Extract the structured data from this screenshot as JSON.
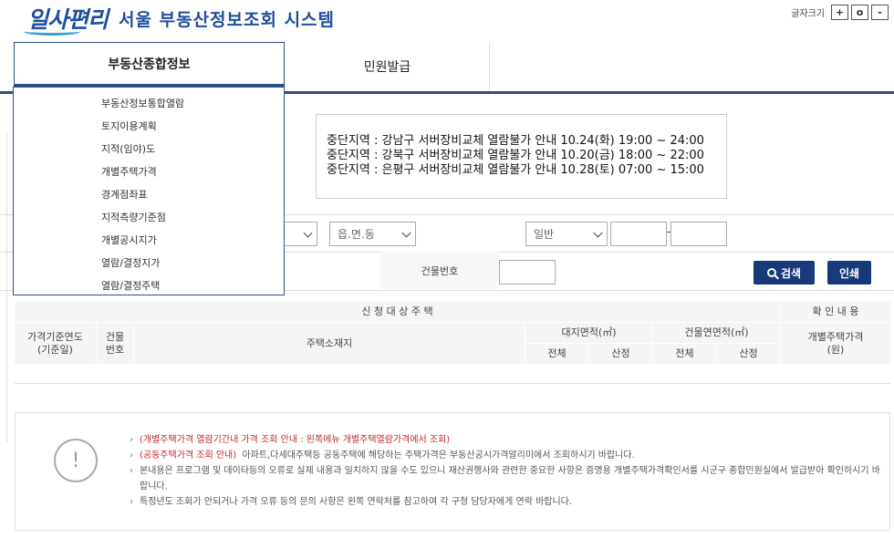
{
  "header": {
    "logo_text": "일사편리",
    "system_title": "서울 부동산정보조회 시스템",
    "fontsize_label": "글자크기",
    "fontsize_plus": "+",
    "fontsize_reset": "o",
    "fontsize_minus": "-"
  },
  "tabs": [
    {
      "label": "부동산종합정보"
    },
    {
      "label": "민원발급"
    }
  ],
  "dropdown": {
    "items": [
      "부동산정보통합열람",
      "토지이용계획",
      "지적(임야)도",
      "개별주택가격",
      "경계점좌표",
      "지적측량기준점",
      "개별공시지가",
      "열람/결정지가",
      "열람/결정주택"
    ]
  },
  "notice": {
    "lines": [
      "중단지역 : 강남구 서버장비교체 열람불가 안내 10.24(화) 19:00 ~ 24:00",
      "중단지역 : 강북구 서버장비교체 열람불가 안내 10.20(금) 18:00 ~ 22:00",
      "중단지역 : 은평구 서버장비교체 열람불가 안내 10.28(토) 07:00 ~ 15:00"
    ]
  },
  "search": {
    "dong_select": "읍.면.동",
    "type_select": "일반",
    "building_label": "건물번호",
    "search_button": "검색",
    "print_button": "인쇄"
  },
  "table": {
    "group_applicant": "신 청 대 상 주 택",
    "group_confirm": "확 인 내 용",
    "col_year": "가격기준연도\n(기준일)",
    "col_bldg": "건물\n번호",
    "col_address": "주택소재지",
    "col_land_area": "대지면적(㎡)",
    "col_bldg_area": "건물연면적(㎡)",
    "col_price": "개별주택가격\n(원)",
    "sub_total": "전체",
    "sub_calc": "산정"
  },
  "info": {
    "icon": "!",
    "line1": "(개별주택가격 열람기간내 가격 조회 안내 : 왼쪽메뉴 개별주택열람가격에서 조회)",
    "line2_red": "(공동주택가격 조회 안내)",
    "line2_rest": "아파트,다세대주택등 공동주택에 해당하는 주택가격은 부동산공시가격알리미에서 조회하시기 바랍니다.",
    "line3": "본내용은 프로그램 및 데이타등의 오류로 실제 내용과 일치하지 않을 수도 있으니 재산권행사와 관련한 중요한 사항은 증명용 개별주택가격확인서를 시군구 종합민원실에서 발급받아 확인하시기 바랍니다.",
    "line4": "특정년도 조회가 안되거나 가격 오류 등의 문의 사항은 왼쪽 연락처를 참고하여 각 구청 담당자에게 연락 바랍니다."
  }
}
